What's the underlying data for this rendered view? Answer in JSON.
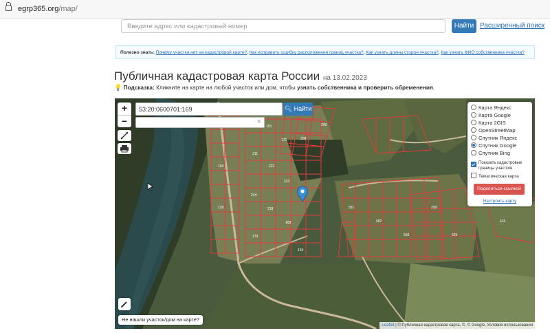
{
  "browser": {
    "url_host": "egrp365.org",
    "url_path": "/map/"
  },
  "search": {
    "placeholder": "Введите адрес или кадастровый номер",
    "button_label": "Найти",
    "advanced_link": "Расширенный поиск"
  },
  "info": {
    "label": "Полезно знать:",
    "links": [
      "Почему участка нет на кадастровой карте?",
      "Как исправить ошибку расположения границ участка?",
      "Как узнать длины сторон участка?",
      "Как узнать ФИО собственника участка?"
    ]
  },
  "page": {
    "title": "Публичная кадастровая карта России",
    "date": "на 13.02.2023",
    "hint_label": "Подсказка:",
    "hint_text": "Кликните на карте на любой участок или дом, чтобы",
    "hint_bold": "узнать собственника и проверить обременения",
    "hint_end": "."
  },
  "map": {
    "cadastral_value": "53:20:0600701:169",
    "find_button": "Найти",
    "zoom_in": "+",
    "zoom_out": "−",
    "layers": [
      {
        "label": "Карта Яндекс",
        "selected": false
      },
      {
        "label": "Карта Google",
        "selected": false
      },
      {
        "label": "Карта 2GIS",
        "selected": false
      },
      {
        "label": "OpenStreetMap",
        "selected": false
      },
      {
        "label": "Спутник Яндекс",
        "selected": false
      },
      {
        "label": "Спутник Google",
        "selected": true
      },
      {
        "label": "Спутник Bing",
        "selected": false
      }
    ],
    "overlay_cadastral": "Показать кадастровые границы участков",
    "overlay_cadastral_checked": true,
    "overlay_thematic": "Тематическая карта",
    "overlay_thematic_checked": false,
    "share_button": "Поделиться ссылкой",
    "setup_link": "Настроить карту",
    "not_found_button": "Не нашли участок/дом на карте?",
    "attribution_leaflet": "Leaflet",
    "attribution_rest": "| © Публичная кадастровая карта, ©, © Google, Условия использования",
    "marker_color": "#3b8fd4",
    "boundary_color": "#e03c3c"
  }
}
